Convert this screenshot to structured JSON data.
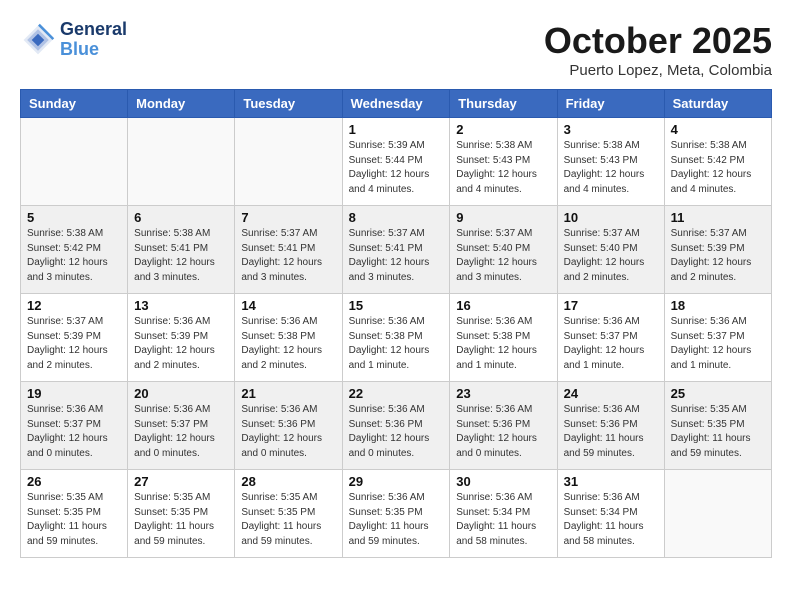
{
  "header": {
    "logo_line1": "General",
    "logo_line2": "Blue",
    "month": "October 2025",
    "location": "Puerto Lopez, Meta, Colombia"
  },
  "weekdays": [
    "Sunday",
    "Monday",
    "Tuesday",
    "Wednesday",
    "Thursday",
    "Friday",
    "Saturday"
  ],
  "weeks": [
    [
      {
        "day": "",
        "info": ""
      },
      {
        "day": "",
        "info": ""
      },
      {
        "day": "",
        "info": ""
      },
      {
        "day": "1",
        "info": "Sunrise: 5:39 AM\nSunset: 5:44 PM\nDaylight: 12 hours\nand 4 minutes."
      },
      {
        "day": "2",
        "info": "Sunrise: 5:38 AM\nSunset: 5:43 PM\nDaylight: 12 hours\nand 4 minutes."
      },
      {
        "day": "3",
        "info": "Sunrise: 5:38 AM\nSunset: 5:43 PM\nDaylight: 12 hours\nand 4 minutes."
      },
      {
        "day": "4",
        "info": "Sunrise: 5:38 AM\nSunset: 5:42 PM\nDaylight: 12 hours\nand 4 minutes."
      }
    ],
    [
      {
        "day": "5",
        "info": "Sunrise: 5:38 AM\nSunset: 5:42 PM\nDaylight: 12 hours\nand 3 minutes."
      },
      {
        "day": "6",
        "info": "Sunrise: 5:38 AM\nSunset: 5:41 PM\nDaylight: 12 hours\nand 3 minutes."
      },
      {
        "day": "7",
        "info": "Sunrise: 5:37 AM\nSunset: 5:41 PM\nDaylight: 12 hours\nand 3 minutes."
      },
      {
        "day": "8",
        "info": "Sunrise: 5:37 AM\nSunset: 5:41 PM\nDaylight: 12 hours\nand 3 minutes."
      },
      {
        "day": "9",
        "info": "Sunrise: 5:37 AM\nSunset: 5:40 PM\nDaylight: 12 hours\nand 3 minutes."
      },
      {
        "day": "10",
        "info": "Sunrise: 5:37 AM\nSunset: 5:40 PM\nDaylight: 12 hours\nand 2 minutes."
      },
      {
        "day": "11",
        "info": "Sunrise: 5:37 AM\nSunset: 5:39 PM\nDaylight: 12 hours\nand 2 minutes."
      }
    ],
    [
      {
        "day": "12",
        "info": "Sunrise: 5:37 AM\nSunset: 5:39 PM\nDaylight: 12 hours\nand 2 minutes."
      },
      {
        "day": "13",
        "info": "Sunrise: 5:36 AM\nSunset: 5:39 PM\nDaylight: 12 hours\nand 2 minutes."
      },
      {
        "day": "14",
        "info": "Sunrise: 5:36 AM\nSunset: 5:38 PM\nDaylight: 12 hours\nand 2 minutes."
      },
      {
        "day": "15",
        "info": "Sunrise: 5:36 AM\nSunset: 5:38 PM\nDaylight: 12 hours\nand 1 minute."
      },
      {
        "day": "16",
        "info": "Sunrise: 5:36 AM\nSunset: 5:38 PM\nDaylight: 12 hours\nand 1 minute."
      },
      {
        "day": "17",
        "info": "Sunrise: 5:36 AM\nSunset: 5:37 PM\nDaylight: 12 hours\nand 1 minute."
      },
      {
        "day": "18",
        "info": "Sunrise: 5:36 AM\nSunset: 5:37 PM\nDaylight: 12 hours\nand 1 minute."
      }
    ],
    [
      {
        "day": "19",
        "info": "Sunrise: 5:36 AM\nSunset: 5:37 PM\nDaylight: 12 hours\nand 0 minutes."
      },
      {
        "day": "20",
        "info": "Sunrise: 5:36 AM\nSunset: 5:37 PM\nDaylight: 12 hours\nand 0 minutes."
      },
      {
        "day": "21",
        "info": "Sunrise: 5:36 AM\nSunset: 5:36 PM\nDaylight: 12 hours\nand 0 minutes."
      },
      {
        "day": "22",
        "info": "Sunrise: 5:36 AM\nSunset: 5:36 PM\nDaylight: 12 hours\nand 0 minutes."
      },
      {
        "day": "23",
        "info": "Sunrise: 5:36 AM\nSunset: 5:36 PM\nDaylight: 12 hours\nand 0 minutes."
      },
      {
        "day": "24",
        "info": "Sunrise: 5:36 AM\nSunset: 5:36 PM\nDaylight: 11 hours\nand 59 minutes."
      },
      {
        "day": "25",
        "info": "Sunrise: 5:35 AM\nSunset: 5:35 PM\nDaylight: 11 hours\nand 59 minutes."
      }
    ],
    [
      {
        "day": "26",
        "info": "Sunrise: 5:35 AM\nSunset: 5:35 PM\nDaylight: 11 hours\nand 59 minutes."
      },
      {
        "day": "27",
        "info": "Sunrise: 5:35 AM\nSunset: 5:35 PM\nDaylight: 11 hours\nand 59 minutes."
      },
      {
        "day": "28",
        "info": "Sunrise: 5:35 AM\nSunset: 5:35 PM\nDaylight: 11 hours\nand 59 minutes."
      },
      {
        "day": "29",
        "info": "Sunrise: 5:36 AM\nSunset: 5:35 PM\nDaylight: 11 hours\nand 59 minutes."
      },
      {
        "day": "30",
        "info": "Sunrise: 5:36 AM\nSunset: 5:34 PM\nDaylight: 11 hours\nand 58 minutes."
      },
      {
        "day": "31",
        "info": "Sunrise: 5:36 AM\nSunset: 5:34 PM\nDaylight: 11 hours\nand 58 minutes."
      },
      {
        "day": "",
        "info": ""
      }
    ]
  ]
}
